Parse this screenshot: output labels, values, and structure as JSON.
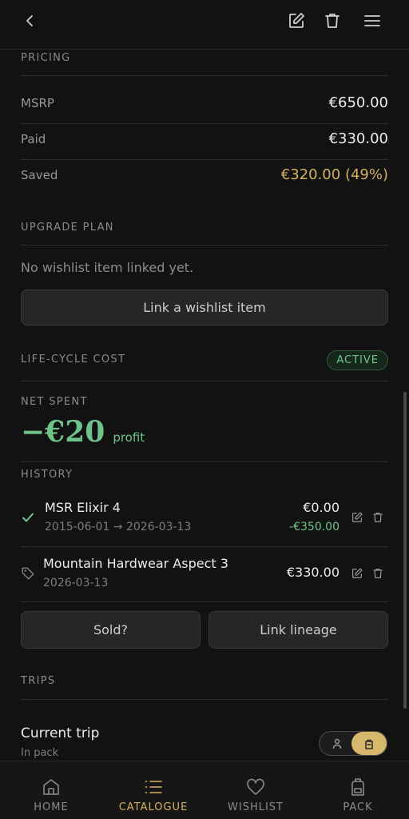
{
  "pricing": {
    "title": "PRICING",
    "rows": [
      {
        "label": "MSRP",
        "value": "€650.00"
      },
      {
        "label": "Paid",
        "value": "€330.00"
      },
      {
        "label": "Saved",
        "value": "€320.00 (49%)"
      }
    ]
  },
  "upgrade": {
    "title": "UPGRADE PLAN",
    "empty_text": "No wishlist item linked yet.",
    "link_button": "Link a wishlist item"
  },
  "lifecycle": {
    "title": "LIFE-CYCLE COST",
    "badge": "ACTIVE",
    "net_spent_label": "NET SPENT",
    "net_value": "−€20",
    "net_note": "profit"
  },
  "history": {
    "title": "HISTORY",
    "items": [
      {
        "name": "MSR Elixir 4",
        "dates": "2015-06-01 → 2026-03-13",
        "amount": "€0.00",
        "delta": "-€350.00",
        "icon": "check-icon"
      },
      {
        "name": "Mountain Hardwear Aspect 3",
        "dates": "2026-03-13",
        "amount": "€330.00",
        "icon": "tag-icon"
      }
    ],
    "sold_button": "Sold?",
    "lineage_button": "Link lineage"
  },
  "trips": {
    "title": "TRIPS",
    "current_title": "Current trip",
    "current_status": "In pack"
  },
  "nav": {
    "items": [
      {
        "label": "HOME",
        "icon": "home-icon"
      },
      {
        "label": "CATALOGUE",
        "icon": "list-icon"
      },
      {
        "label": "WISHLIST",
        "icon": "heart-icon"
      },
      {
        "label": "PACK",
        "icon": "backpack-icon"
      }
    ],
    "active": "CATALOGUE"
  },
  "colors": {
    "accent": "#d4b15f",
    "positive": "#6fc48a",
    "background": "#121212"
  }
}
